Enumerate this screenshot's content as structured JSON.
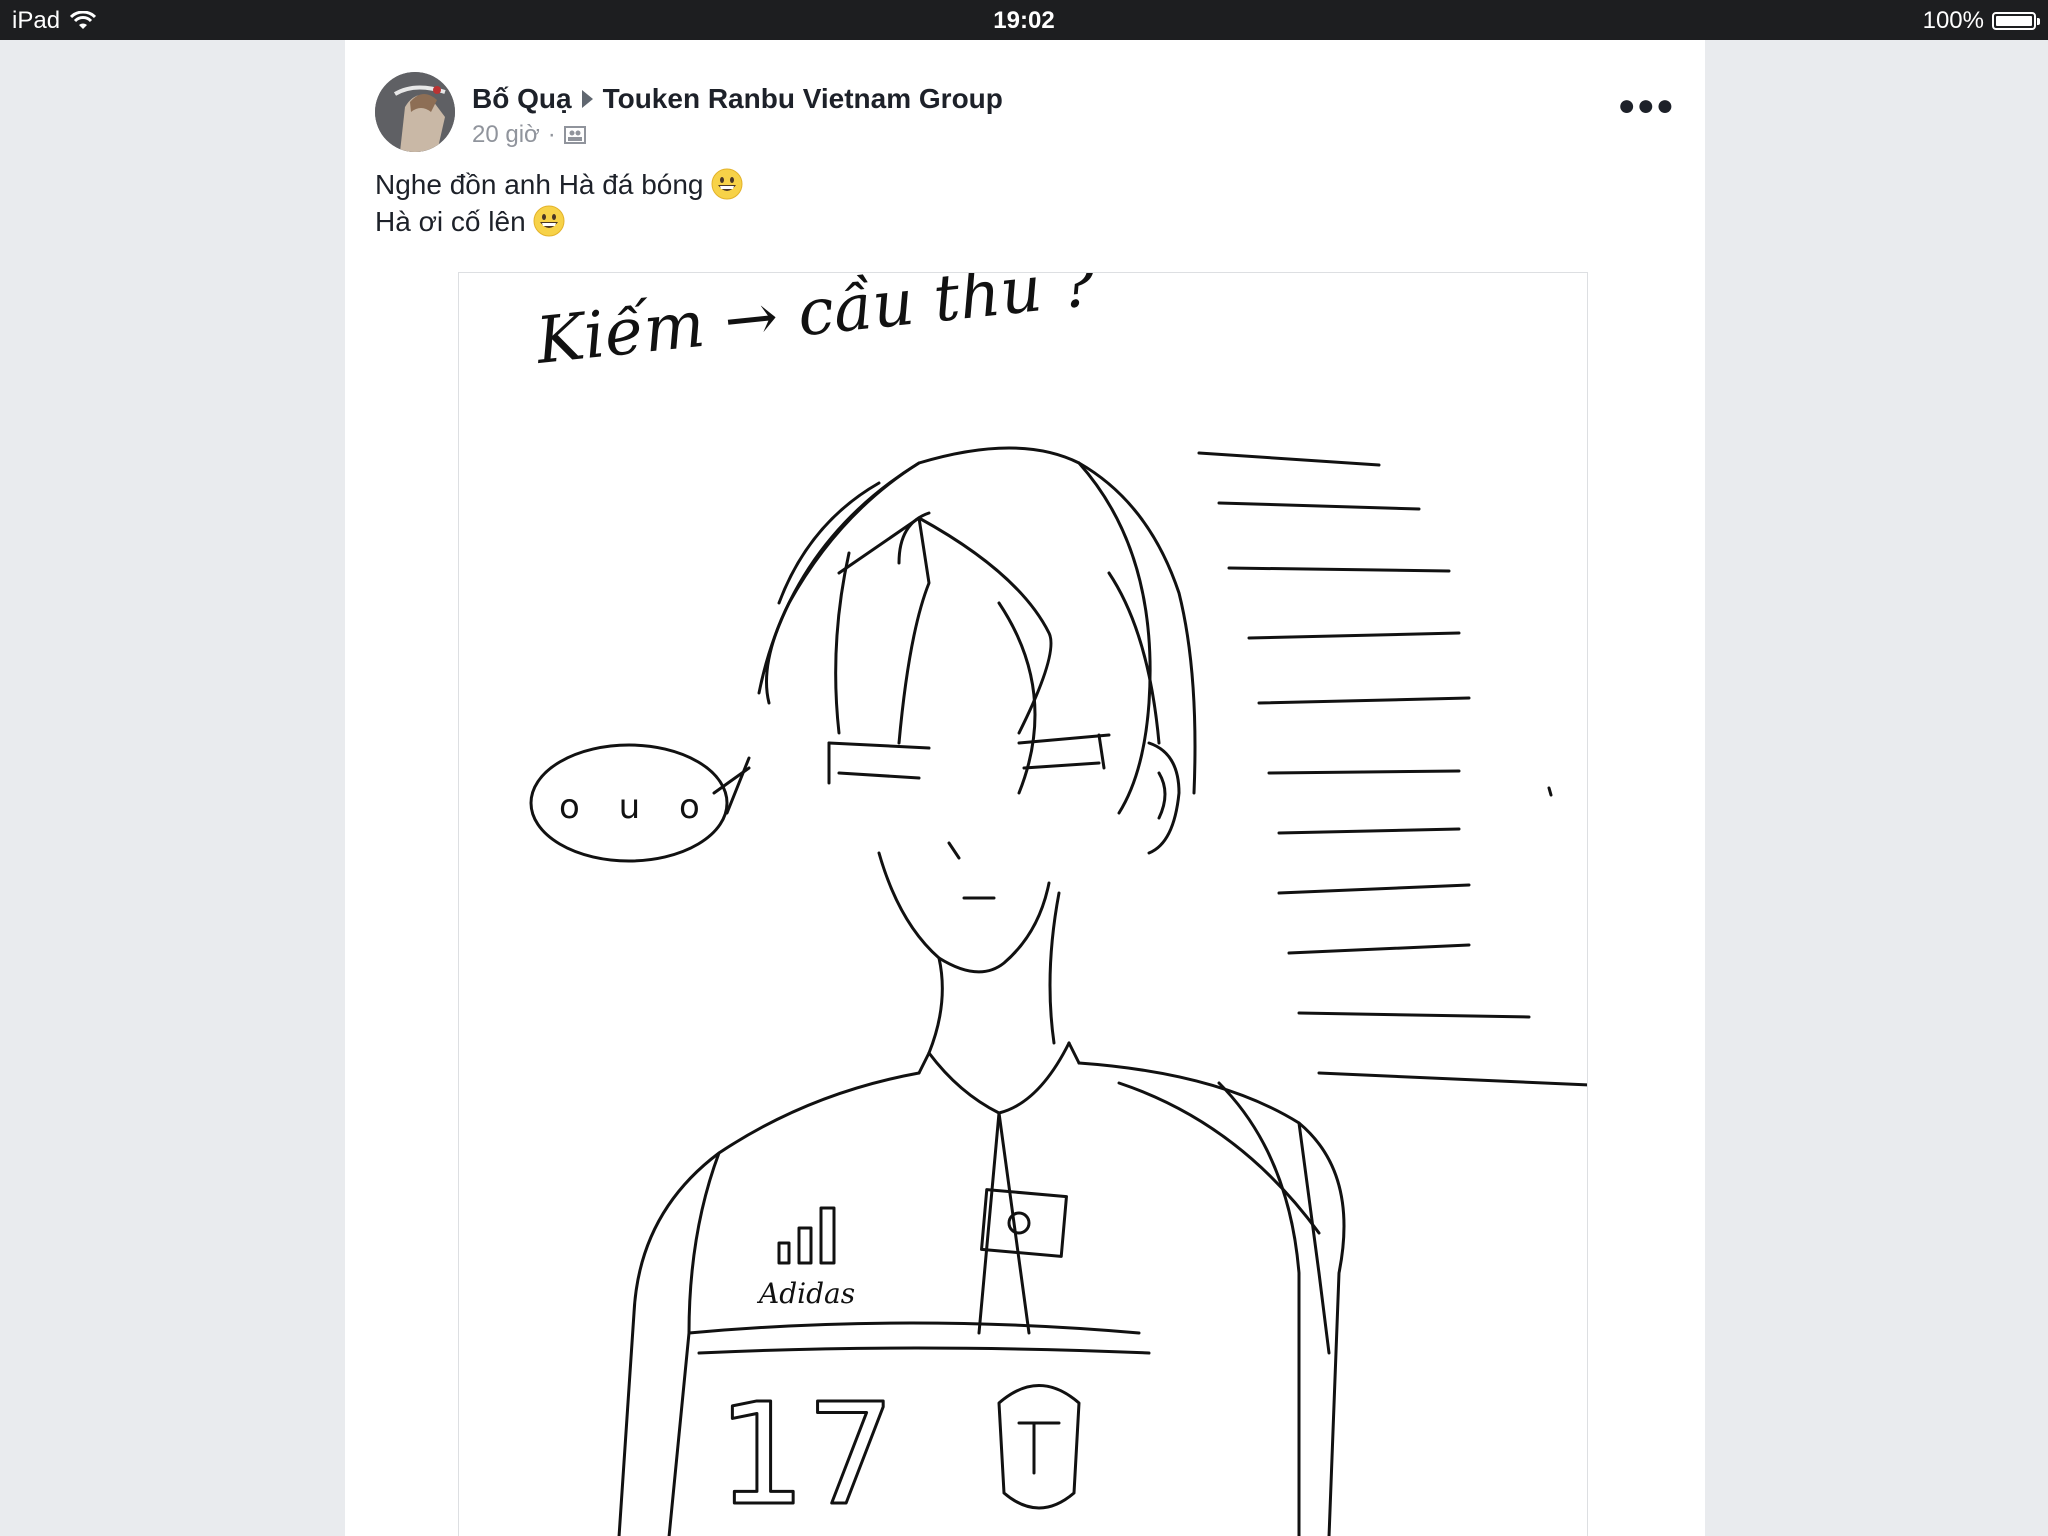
{
  "status_bar": {
    "device": "iPad",
    "time": "19:02",
    "battery": "100%",
    "battery_level": 1.0
  },
  "post": {
    "author": "Bố Quạ",
    "group": "Touken Ranbu Vietnam Group",
    "time": "20 giờ",
    "separator": "·",
    "message_lines": [
      "Nghe đồn anh Hà đá bóng",
      "Hà ơi cố lên"
    ]
  },
  "image_text": {
    "caption": "Kiếm → cầu thủ ?",
    "speech": "o u o",
    "brand": "Adidas",
    "number": "17"
  },
  "icons": {
    "wifi": "wifi-icon",
    "battery": "battery-icon",
    "audience": "group-audience-icon",
    "more": "more-options-icon",
    "emoji": "grinning-face-emoji"
  }
}
